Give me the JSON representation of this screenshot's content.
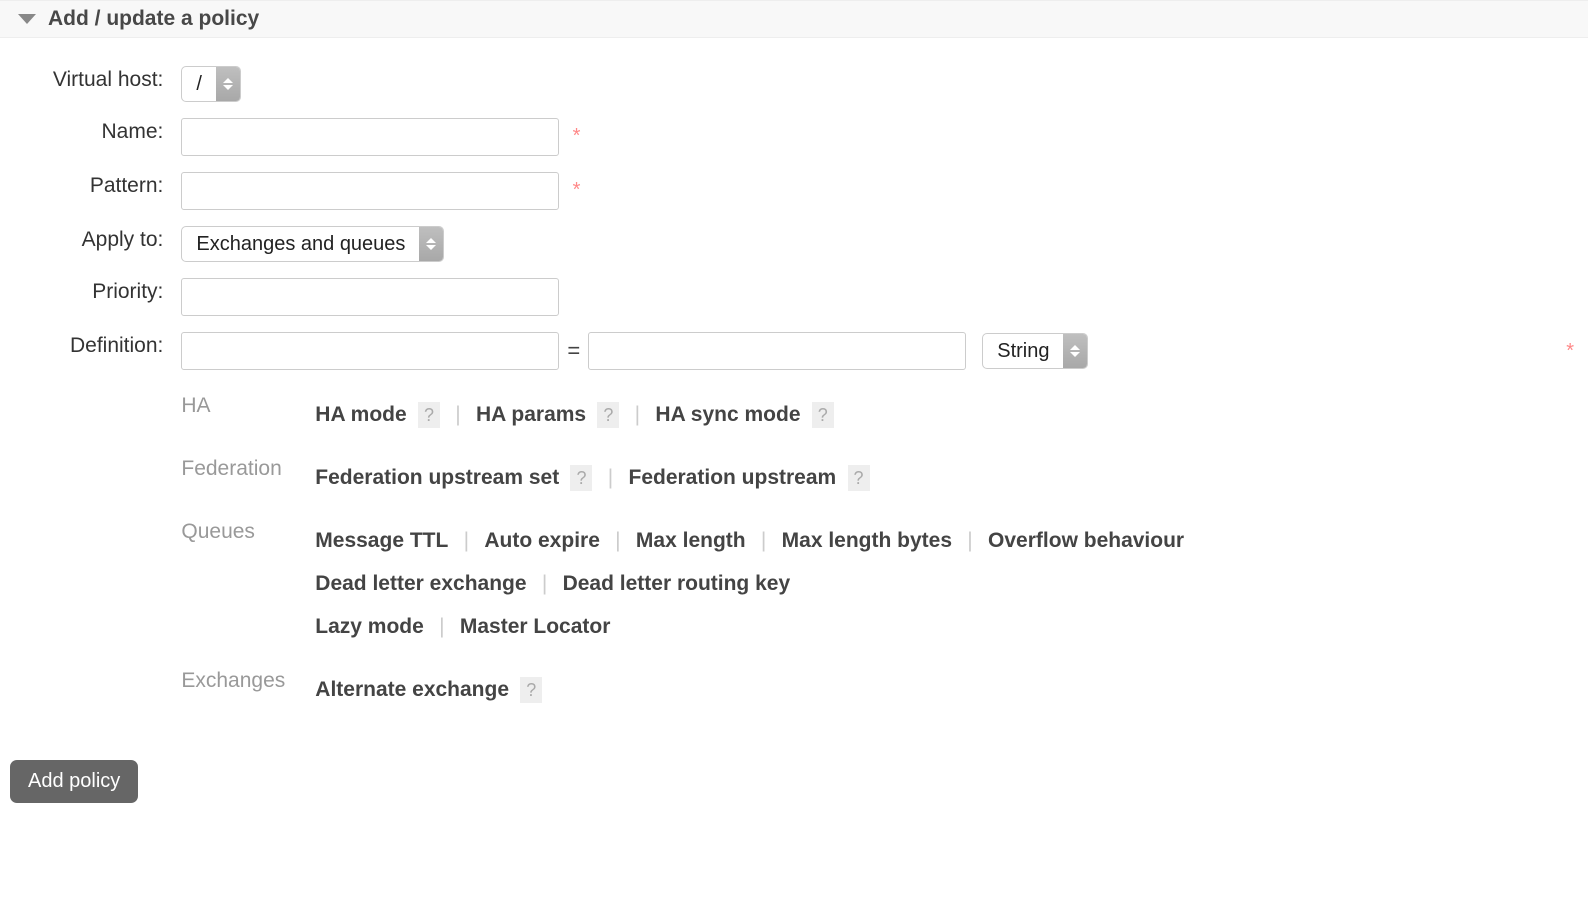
{
  "section_title": "Add / update a policy",
  "labels": {
    "vhost": "Virtual host:",
    "name": "Name:",
    "pattern": "Pattern:",
    "apply_to": "Apply to:",
    "priority": "Priority:",
    "definition": "Definition:"
  },
  "fields": {
    "vhost_selected": "/",
    "name_value": "",
    "pattern_value": "",
    "apply_to_selected": "Exchanges and queues",
    "priority_value": "",
    "def_key": "",
    "def_val": "",
    "def_type_selected": "String"
  },
  "symbols": {
    "equals": "=",
    "required": "*",
    "help": "?"
  },
  "shortcuts": {
    "ha": {
      "label": "HA",
      "items": [
        "HA mode",
        "HA params",
        "HA sync mode"
      ],
      "helps": [
        true,
        true,
        true
      ]
    },
    "federation": {
      "label": "Federation",
      "items": [
        "Federation upstream set",
        "Federation upstream"
      ],
      "helps": [
        true,
        true
      ]
    },
    "queues": {
      "label": "Queues",
      "line1": [
        "Message TTL",
        "Auto expire",
        "Max length",
        "Max length bytes",
        "Overflow behaviour"
      ],
      "line2": [
        "Dead letter exchange",
        "Dead letter routing key"
      ],
      "line3": [
        "Lazy mode",
        "Master Locator"
      ]
    },
    "exchanges": {
      "label": "Exchanges",
      "items": [
        "Alternate exchange"
      ],
      "helps": [
        true
      ]
    }
  },
  "submit_label": "Add policy"
}
